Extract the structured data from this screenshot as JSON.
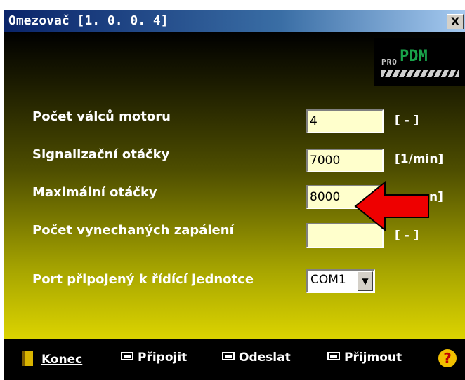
{
  "window": {
    "title": "Omezovač [1. 0. 0. 4]",
    "close_label": "X"
  },
  "logo": {
    "pro": "PRO",
    "pdm": "PDM"
  },
  "form": {
    "rows": [
      {
        "label": "Počet válců motoru",
        "value": "4",
        "unit": "[   -   ]"
      },
      {
        "label": "Signalizační otáčky",
        "value": "7000",
        "unit": "[1/min]"
      },
      {
        "label": "Maximální otáčky",
        "value": "8000",
        "unit": "n]"
      },
      {
        "label": "Počet vynechaných zapálení",
        "value": "",
        "unit": "[   -   ]"
      }
    ],
    "port": {
      "label": "Port připojený k řídící jednotce",
      "value": "COM1",
      "dropdown_glyph": "▼"
    }
  },
  "annotation": {
    "arrow_color": "#ee0000"
  },
  "footer": {
    "konec": "Konec",
    "pripojit": "Připojit",
    "odeslat": "Odeslat",
    "prijmout": "Přijmout",
    "help_glyph": "?"
  }
}
